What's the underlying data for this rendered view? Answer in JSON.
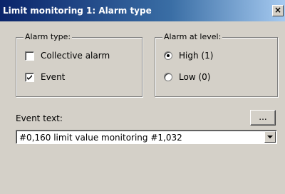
{
  "window": {
    "title": "Limit monitoring 1: Alarm type",
    "close_label": "×"
  },
  "alarm_type": {
    "legend": "Alarm type:",
    "options": [
      {
        "label": "Collective alarm",
        "checked": false
      },
      {
        "label": "Event",
        "checked": true
      }
    ]
  },
  "alarm_level": {
    "legend": "Alarm at level:",
    "options": [
      {
        "label": "High (1)",
        "selected": true
      },
      {
        "label": "Low (0)",
        "selected": false
      }
    ]
  },
  "event_text": {
    "label": "Event text:",
    "browse_label": "...",
    "value": "#0,160 limit value monitoring #1,032"
  }
}
